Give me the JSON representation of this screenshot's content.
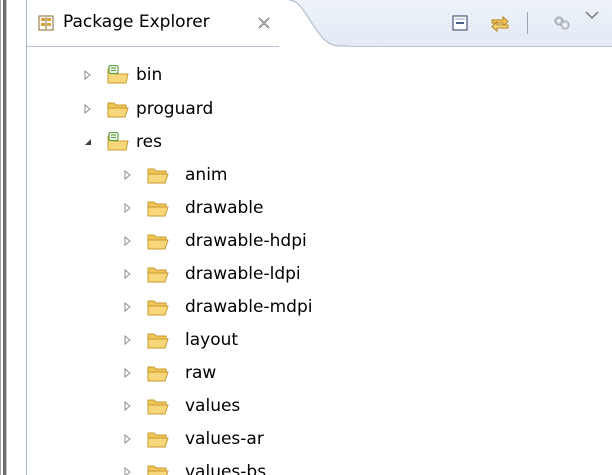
{
  "view": {
    "title": "Package Explorer",
    "close_icon": "close-x-icon",
    "toolbar": [
      {
        "name": "collapse-all-button",
        "icon": "collapse-all-icon"
      },
      {
        "name": "link-with-editor-button",
        "icon": "link-with-editor-icon"
      },
      {
        "name": "view-menu-dots-button",
        "icon": "gear-icon"
      },
      {
        "name": "view-menu-button",
        "icon": "chevron-down-icon"
      }
    ]
  },
  "tree": {
    "nodes": [
      {
        "label": "bin",
        "depth": 0,
        "expanded": false,
        "icon": "source-folder-icon"
      },
      {
        "label": "proguard",
        "depth": 0,
        "expanded": false,
        "icon": "folder-icon"
      },
      {
        "label": "res",
        "depth": 0,
        "expanded": true,
        "icon": "source-folder-icon"
      },
      {
        "label": "anim",
        "depth": 1,
        "expanded": false,
        "icon": "folder-icon"
      },
      {
        "label": "drawable",
        "depth": 1,
        "expanded": false,
        "icon": "folder-icon"
      },
      {
        "label": "drawable-hdpi",
        "depth": 1,
        "expanded": false,
        "icon": "folder-icon"
      },
      {
        "label": "drawable-ldpi",
        "depth": 1,
        "expanded": false,
        "icon": "folder-icon"
      },
      {
        "label": "drawable-mdpi",
        "depth": 1,
        "expanded": false,
        "icon": "folder-icon"
      },
      {
        "label": "layout",
        "depth": 1,
        "expanded": false,
        "icon": "folder-icon"
      },
      {
        "label": "raw",
        "depth": 1,
        "expanded": false,
        "icon": "folder-icon"
      },
      {
        "label": "values",
        "depth": 1,
        "expanded": false,
        "icon": "folder-icon"
      },
      {
        "label": "values-ar",
        "depth": 1,
        "expanded": false,
        "icon": "folder-icon"
      },
      {
        "label": "values-bs",
        "depth": 1,
        "expanded": false,
        "icon": "folder-icon"
      }
    ]
  },
  "colors": {
    "folder_fill": "#f7d77a",
    "folder_stroke": "#c79a2e",
    "source_badge": "#5aa03c",
    "header_bg": "#e3eaf4",
    "border": "#a7b5c9"
  }
}
